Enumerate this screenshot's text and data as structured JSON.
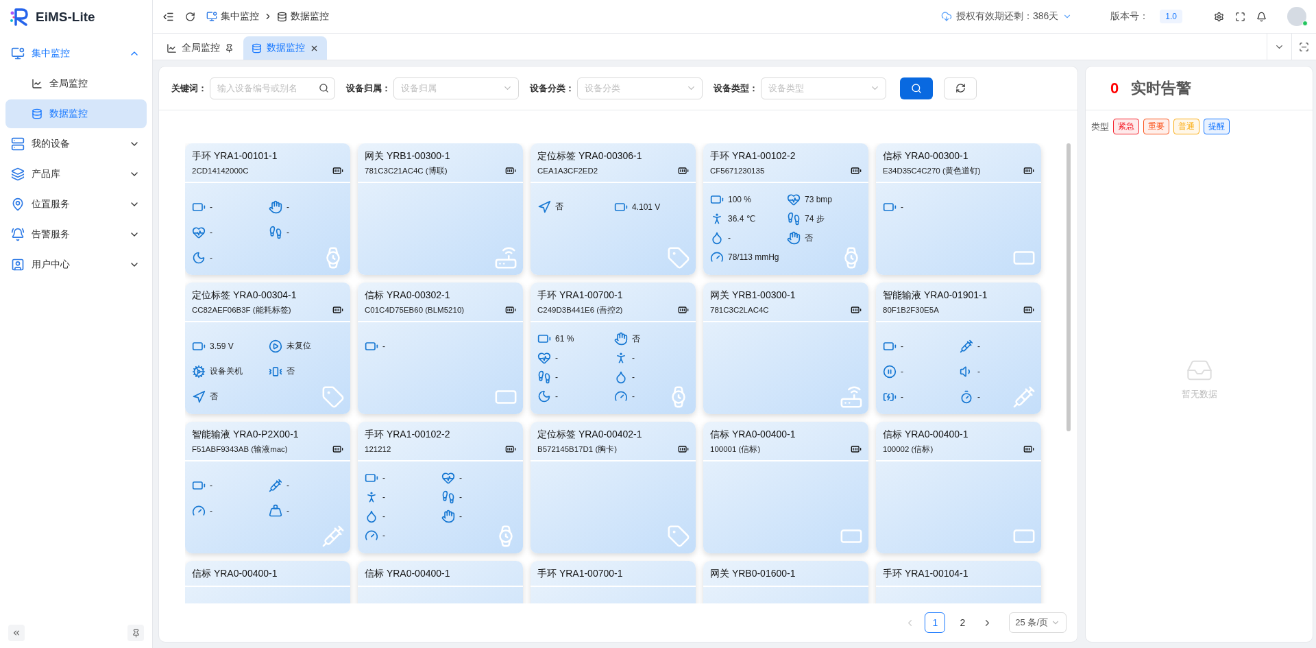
{
  "brand": {
    "name": "EiMS-Lite"
  },
  "sidebar": {
    "items": [
      {
        "label": "集中监控",
        "selected": true,
        "expanded": true,
        "children": [
          {
            "label": "全局监控",
            "selected": false
          },
          {
            "label": "数据监控",
            "selected": true
          }
        ]
      },
      {
        "label": "我的设备",
        "selected": false,
        "expanded": false
      },
      {
        "label": "产品库",
        "selected": false,
        "expanded": false
      },
      {
        "label": "位置服务",
        "selected": false,
        "expanded": false
      },
      {
        "label": "告警服务",
        "selected": false,
        "expanded": false
      },
      {
        "label": "用户中心",
        "selected": false,
        "expanded": false
      }
    ]
  },
  "header": {
    "breadcrumb": [
      "集中监控",
      "数据监控"
    ],
    "license": "授权有效期还剩：386天",
    "version_label": "版本号：",
    "version": "1.0",
    "user_online": true
  },
  "tabs": [
    {
      "label": "全局监控",
      "selected": false,
      "pinned": true,
      "closable": false
    },
    {
      "label": "数据监控",
      "selected": true,
      "pinned": false,
      "closable": true
    }
  ],
  "filters": [
    {
      "kind": "search",
      "label": "关键词：",
      "placeholder": "输入设备编号或别名"
    },
    {
      "kind": "select",
      "label": "设备归属：",
      "placeholder": "设备归属"
    },
    {
      "kind": "select",
      "label": "设备分类：",
      "placeholder": "设备分类"
    },
    {
      "kind": "select",
      "label": "设备类型：",
      "placeholder": "设备类型"
    }
  ],
  "devices": [
    {
      "title": "手环 YRA1-00101-1",
      "subtitle": "2CD14142000C",
      "kind": "watch",
      "metrics": [
        {
          "kind": "battery",
          "value": "-"
        },
        {
          "kind": "hand",
          "value": "-"
        },
        {
          "kind": "heart",
          "value": "-"
        },
        {
          "kind": "steps",
          "value": "-"
        },
        {
          "kind": "sleep",
          "value": "-"
        }
      ]
    },
    {
      "title": "网关 YRB1-00300-1",
      "subtitle": "781C3C21AC4C (博联)",
      "kind": "gateway"
    },
    {
      "title": "定位标签 YRA0-00306-1",
      "subtitle": "CEA1A3CF2ED2",
      "kind": "tag",
      "metrics": [
        {
          "kind": "location",
          "value": "否"
        },
        {
          "kind": "battery",
          "value": "4.101 V"
        }
      ]
    },
    {
      "title": "手环 YRA1-00102-2",
      "subtitle": "CF5671230135",
      "kind": "watch",
      "metrics": [
        {
          "kind": "battery",
          "value": "100 %"
        },
        {
          "kind": "heart",
          "value": "73 bmp"
        },
        {
          "kind": "temperature",
          "value": "36.4 ℃"
        },
        {
          "kind": "steps",
          "value": "74 步"
        },
        {
          "kind": "oxygen",
          "value": "-"
        },
        {
          "kind": "hand",
          "value": "否"
        },
        {
          "kind": "pressure",
          "value": "78/113 mmHg"
        }
      ]
    },
    {
      "title": "信标 YRA0-00300-1",
      "subtitle": "E34D35C4C270 (黄色道钉)",
      "kind": "beacon",
      "metrics": [
        {
          "kind": "battery",
          "value": "-"
        }
      ]
    },
    {
      "title": "定位标签 YRA0-00304-1",
      "subtitle": "CC82AEF06B3F (能耗标签)",
      "kind": "tag",
      "metrics": [
        {
          "kind": "battery",
          "value": "3.59 V"
        },
        {
          "kind": "reset",
          "value": "未复位"
        },
        {
          "kind": "power",
          "value": "设备关机"
        },
        {
          "kind": "wave",
          "value": "否"
        },
        {
          "kind": "location",
          "value": "否"
        }
      ]
    },
    {
      "title": "信标 YRA0-00302-1",
      "subtitle": "C01C4D75EB60 (BLM5210)",
      "kind": "beacon",
      "metrics": [
        {
          "kind": "battery",
          "value": "-"
        }
      ]
    },
    {
      "title": "手环 YRA1-00700-1",
      "subtitle": "C249D3B441E6 (吾控2)",
      "kind": "watch",
      "metrics": [
        {
          "kind": "battery",
          "value": "61 %"
        },
        {
          "kind": "hand",
          "value": "否"
        },
        {
          "kind": "heart",
          "value": "-"
        },
        {
          "kind": "temperature",
          "value": "-"
        },
        {
          "kind": "steps",
          "value": "-"
        },
        {
          "kind": "oxygen",
          "value": "-"
        },
        {
          "kind": "sleep",
          "value": "-"
        },
        {
          "kind": "pressure",
          "value": "-"
        }
      ]
    },
    {
      "title": "网关 YRB1-00300-1",
      "subtitle": "781C3C2LAC4C",
      "kind": "gateway"
    },
    {
      "title": "智能输液 YRA0-01901-1",
      "subtitle": "80F1B2F30E5A",
      "kind": "infusion",
      "metrics": [
        {
          "kind": "battery",
          "value": "-"
        },
        {
          "kind": "drip",
          "value": "-"
        },
        {
          "kind": "pause",
          "value": "-"
        },
        {
          "kind": "volume",
          "value": "-"
        },
        {
          "kind": "charging",
          "value": "-"
        },
        {
          "kind": "timer",
          "value": "-"
        }
      ]
    },
    {
      "title": "智能输液 YRA0-P2X00-1",
      "subtitle": "F51ABF9343AB (输液mac)",
      "kind": "infusion",
      "metrics": [
        {
          "kind": "battery",
          "value": "-"
        },
        {
          "kind": "drip",
          "value": "-"
        },
        {
          "kind": "speed",
          "value": "-"
        },
        {
          "kind": "weight",
          "value": "-"
        }
      ]
    },
    {
      "title": "手环 YRA1-00102-2",
      "subtitle": "121212",
      "kind": "watch",
      "metrics": [
        {
          "kind": "battery",
          "value": "-"
        },
        {
          "kind": "heart",
          "value": "-"
        },
        {
          "kind": "temperature",
          "value": "-"
        },
        {
          "kind": "steps",
          "value": "-"
        },
        {
          "kind": "oxygen",
          "value": "-"
        },
        {
          "kind": "hand",
          "value": "-"
        },
        {
          "kind": "pressure",
          "value": "-"
        }
      ]
    },
    {
      "title": "定位标签 YRA0-00402-1",
      "subtitle": "B572145B17D1 (胸卡)",
      "kind": "tag"
    },
    {
      "title": "信标 YRA0-00400-1",
      "subtitle": "100001 (信标)",
      "kind": "beacon"
    },
    {
      "title": "信标 YRA0-00400-1",
      "subtitle": "100002 (信标)",
      "kind": "beacon"
    },
    {
      "title": "信标 YRA0-00400-1"
    },
    {
      "title": "信标 YRA0-00400-1"
    },
    {
      "title": "手环 YRA1-00700-1"
    },
    {
      "title": "网关 YRB0-01600-1"
    },
    {
      "title": "手环 YRA1-00104-1"
    }
  ],
  "pagination": {
    "pages": [
      {
        "label": "1",
        "selected": true
      },
      {
        "label": "2",
        "selected": false
      }
    ],
    "page_size": "25 条/页"
  },
  "alerts": {
    "count": "0",
    "title": "实时告警",
    "filter_label": "类型",
    "tags": [
      {
        "label": "紧急",
        "color": "#f5222d"
      },
      {
        "label": "重要",
        "color": "#fa541c"
      },
      {
        "label": "普通",
        "color": "#faad14"
      },
      {
        "label": "提醒",
        "color": "#1677ff"
      }
    ],
    "empty": "暂无数据"
  }
}
